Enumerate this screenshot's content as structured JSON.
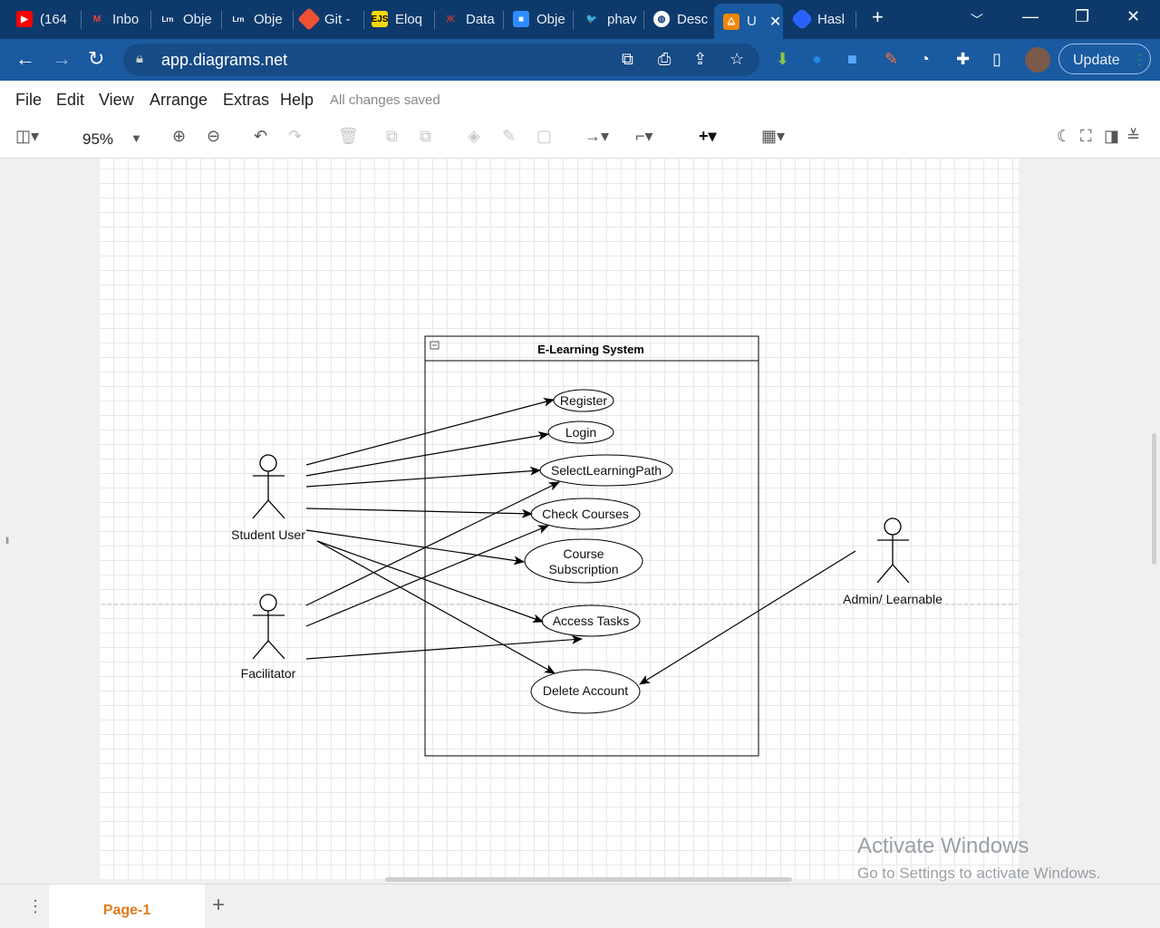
{
  "browser": {
    "tabs": [
      {
        "label": "(164",
        "icon": "youtube-icon",
        "color": "#ff0000"
      },
      {
        "label": "Inbo",
        "icon": "gmail-icon",
        "color": "#ea4335"
      },
      {
        "label": "Obje",
        "icon": "learnable-icon",
        "color": "#333333"
      },
      {
        "label": "Obje",
        "icon": "learnable-icon",
        "color": "#333333"
      },
      {
        "label": "Git -",
        "icon": "git-icon",
        "color": "#f05033"
      },
      {
        "label": "Eloq",
        "icon": "ejs-icon",
        "color": "#f5d90a"
      },
      {
        "label": "Data",
        "icon": "tower-icon",
        "color": "#c0392b"
      },
      {
        "label": "Obje",
        "icon": "zoom-icon",
        "color": "#2d8cff"
      },
      {
        "label": "phav",
        "icon": "twitter-icon",
        "color": "#1da1f2"
      },
      {
        "label": "Desc",
        "icon": "globe-icon",
        "color": "#ffffff"
      },
      {
        "label": "U",
        "icon": "drawio-icon",
        "color": "#f08705"
      },
      {
        "label": "Hasl",
        "icon": "hashnode-icon",
        "color": "#2962ff"
      }
    ],
    "url": "app.diagrams.net",
    "update_label": "Update"
  },
  "menu": {
    "items": [
      "File",
      "Edit",
      "View",
      "Arrange",
      "Extras",
      "Help"
    ],
    "status": "All changes saved"
  },
  "toolbar": {
    "zoom": "95%"
  },
  "diagram": {
    "frame_title": "E-Learning System",
    "actors": {
      "student": "Student User",
      "facilitator": "Facilitator",
      "admin": "Admin/ Learnable"
    },
    "use_cases": {
      "register": "Register",
      "login": "Login",
      "select": "SelectLearningPath",
      "check": "Check Courses",
      "sub1": "Course",
      "sub2": "Subscription",
      "access": "Access Tasks",
      "delete": "Delete Account"
    }
  },
  "watermark": {
    "title": "Activate Windows",
    "subtitle": "Go to Settings to activate Windows."
  },
  "pages": {
    "current": "Page-1"
  }
}
